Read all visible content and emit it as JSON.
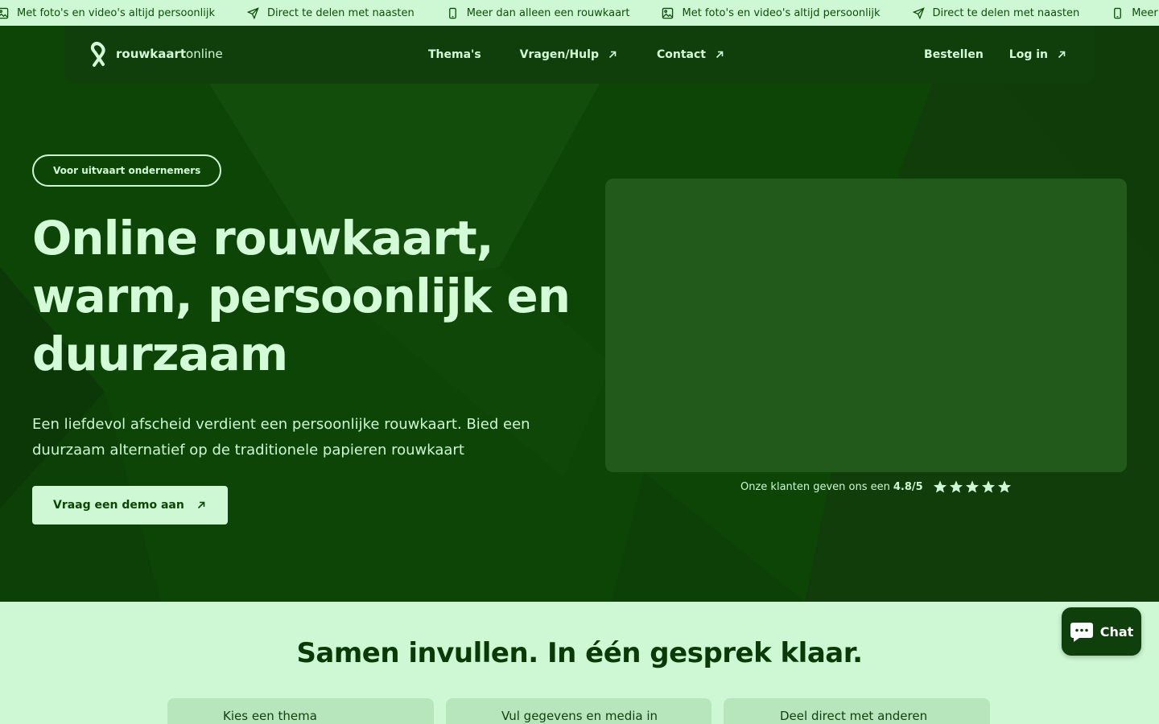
{
  "ticker": {
    "items": [
      {
        "icon": "image-icon",
        "text": "Met foto's en video's altijd persoonlijk"
      },
      {
        "icon": "send-icon",
        "text": "Direct te delen met naasten"
      },
      {
        "icon": "phone-icon",
        "text": "Meer dan alleen een rouwkaart"
      },
      {
        "icon": "image-icon",
        "text": "Met foto's en video's altijd persoonlijk"
      },
      {
        "icon": "send-icon",
        "text": "Direct te delen met naasten"
      },
      {
        "icon": "phone-icon",
        "text": "Meer dan alleen een rouwkaart"
      }
    ]
  },
  "header": {
    "logo_bold": "rouwkaart",
    "logo_light": "online",
    "nav_themes": "Thema's",
    "nav_help": "Vragen/Hulp",
    "nav_contact": "Contact",
    "nav_order": "Bestellen",
    "nav_login": "Log in"
  },
  "hero": {
    "badge": "Voor uitvaart ondernemers",
    "title": "Online rouwkaart, warm, persoonlijk en duurzaam",
    "subtitle": "Een liefdevol afscheid verdient een persoonlijke rouwkaart. Bied een duurzaam alternatief op de traditionele papieren rouwkaart",
    "cta": "Vraag een demo aan",
    "rating_text": "Onze klanten geven ons een",
    "rating_value": "4.8/5",
    "rating_stars": 5
  },
  "section": {
    "title": "Samen invullen. In één gesprek klaar.",
    "steps": [
      {
        "label": "Kies een thema"
      },
      {
        "label": "Vul gegevens en media in"
      },
      {
        "label": "Deel direct met anderen"
      }
    ]
  },
  "chat": {
    "label": "Chat"
  },
  "colors": {
    "dark_green": "#0d4507",
    "mint": "#cdf8d3",
    "video_placeholder": "#215a1a"
  }
}
